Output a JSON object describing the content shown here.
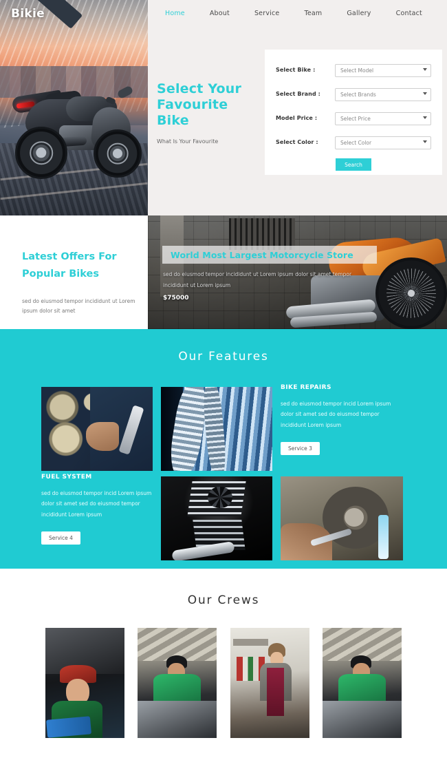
{
  "header": {
    "logo": "Bikie",
    "nav": [
      {
        "label": "Home",
        "active": true
      },
      {
        "label": "About",
        "active": false
      },
      {
        "label": "Service",
        "active": false
      },
      {
        "label": "Team",
        "active": false
      },
      {
        "label": "Gallery",
        "active": false
      },
      {
        "label": "Contact",
        "active": false
      }
    ]
  },
  "hero": {
    "title_line1": "Select Your",
    "title_line2": "Favourite Bike",
    "subtitle": "What Is Your Favourite"
  },
  "search_form": {
    "fields": [
      {
        "label": "Select Bike :",
        "value": "Select Model"
      },
      {
        "label": "Select Brand :",
        "value": "Select Brands"
      },
      {
        "label": "Model Price :",
        "value": "Select Price"
      },
      {
        "label": "Select Color :",
        "value": "Select Color"
      }
    ],
    "submit_label": "Search"
  },
  "offers": {
    "title_line1": "Latest Offers For",
    "title_line2": "Popular Bikes",
    "description": "sed do eiusmod tempor incididunt ut Lorem ipsum dolor sit amet"
  },
  "banner": {
    "title": "World Most Largest Motorcycle Store",
    "description": "sed do eiusmod tempor incididunt ut Lorem ipsum dolor sit amet tempor incididunt ut Lorem ipsum",
    "price": "$75000"
  },
  "features": {
    "heading": "Our Features",
    "items": [
      {
        "title": "BIKE REPAIRS",
        "description": "sed do eiusmod tempor incid Lorem ipsum dolor sit amet sed do eiusmod tempor incididunt Lorem ipsum",
        "button_label": "Service 3"
      },
      {
        "title": "FUEL SYSTEM",
        "description": "sed do eiusmod tempor incid Lorem ipsum dolor sit amet sed do eiusmod tempor incididunt Lorem ipsum",
        "button_label": "Service 4"
      }
    ],
    "images": [
      "mechanic-with-wrench-and-wheels-photo",
      "blue-engine-hoses-photo",
      "dark-motorcycle-engine-photo",
      "brake-disc-repair-photo"
    ]
  },
  "crews": {
    "heading": "Our Crews",
    "members": [
      "crew-member-photo-1",
      "crew-member-photo-2",
      "crew-member-photo-3",
      "crew-member-photo-4"
    ]
  },
  "colors": {
    "accent_teal": "#2ecfd6",
    "features_bg": "#20cbd2",
    "hero_bg": "#f2efee",
    "text_dark": "#333333"
  }
}
